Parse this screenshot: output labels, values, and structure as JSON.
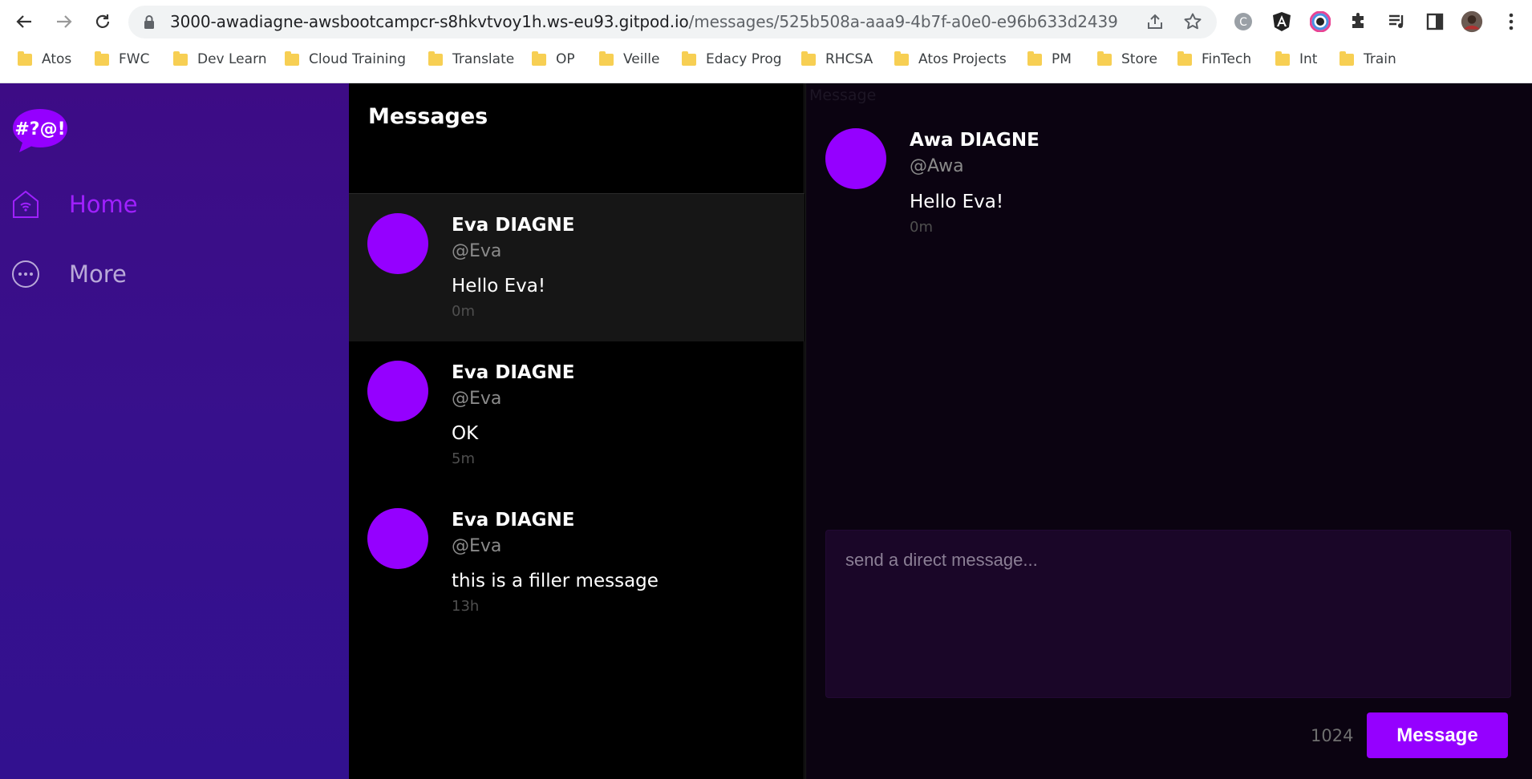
{
  "browser": {
    "url_host": "3000-awadiagne-awsbootcampcr-s8hkvtvoy1h.ws-eu93.gitpod.io",
    "url_path": "/messages/525b508a-aaa9-4b7f-a0e0-e96b633d2439",
    "bookmarks": [
      "Atos",
      "FWC",
      "Dev Learn",
      "Cloud Training",
      "Translate",
      "OP",
      "Veille",
      "Edacy Prog",
      "RHCSA",
      "Atos Projects",
      "PM",
      "Store",
      "FinTech",
      "Int",
      "Train"
    ]
  },
  "sidebar": {
    "logo_text": "#?@!",
    "items": [
      {
        "label": "Home",
        "icon": "home-icon"
      },
      {
        "label": "More",
        "icon": "more-icon"
      }
    ]
  },
  "feed": {
    "title": "Messages",
    "messages": [
      {
        "name": "Eva DIAGNE",
        "handle": "@Eva",
        "text": "Hello Eva!",
        "time": "0m"
      },
      {
        "name": "Eva DIAGNE",
        "handle": "@Eva",
        "text": "OK",
        "time": "5m"
      },
      {
        "name": "Eva DIAGNE",
        "handle": "@Eva",
        "text": "this is a filler message",
        "time": "13h"
      }
    ]
  },
  "conversation": {
    "label": "Message",
    "messages": [
      {
        "name": "Awa DIAGNE",
        "handle": "@Awa",
        "text": "Hello Eva!",
        "time": "0m"
      }
    ],
    "composer": {
      "placeholder": "send a direct message...",
      "counter": "1024",
      "button_label": "Message"
    }
  },
  "colors": {
    "accent": "#9500ff",
    "sidebar": "#3d0c85",
    "home_active": "#a020ff"
  }
}
